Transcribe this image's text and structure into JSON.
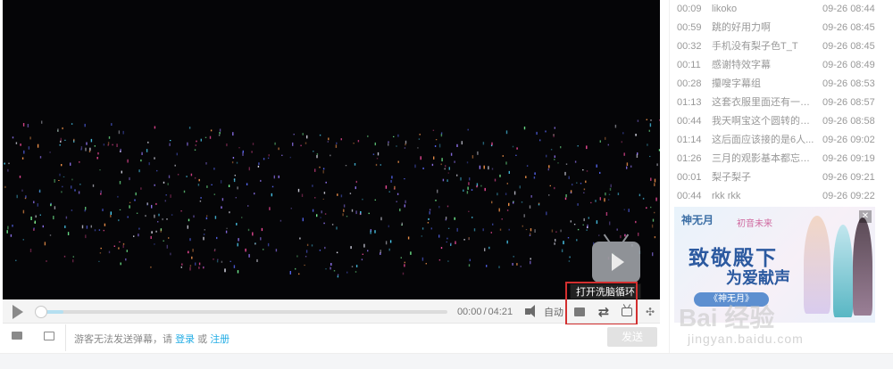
{
  "player": {
    "big_play_icon": "tv-play-icon",
    "tooltip": "打开洗脑循环",
    "time_current": "00:00",
    "time_separator": "/",
    "time_total": "04:21",
    "progress": 0,
    "auto_label": "自动",
    "loop_icon": "loop-icon",
    "accent": "#23ade5",
    "highlight_color": "#d32f2f"
  },
  "sendbar": {
    "hint_prefix": "游客无法发送弹幕，请",
    "login": "登录",
    "or": "或",
    "register": "注册",
    "send": "发送"
  },
  "danmaku": [
    {
      "time": "00:09",
      "content": "likoko",
      "date": "09-26 08:44"
    },
    {
      "time": "00:59",
      "content": "跳的好用力啊",
      "date": "09-26 08:45"
    },
    {
      "time": "00:32",
      "content": "手机没有梨子色T_T",
      "date": "09-26 08:45"
    },
    {
      "time": "00:11",
      "content": "感谢特效字幕",
      "date": "09-26 08:49"
    },
    {
      "time": "00:28",
      "content": "攥嗖字幕组",
      "date": "09-26 08:53"
    },
    {
      "time": "01:13",
      "content": "这套衣服里面还有一套...",
      "date": "09-26 08:57"
    },
    {
      "time": "00:44",
      "content": "我天啊宝这个圆转的要...",
      "date": "09-26 08:58"
    },
    {
      "time": "01:14",
      "content": "这后面应该接的是6人...",
      "date": "09-26 09:02"
    },
    {
      "time": "01:26",
      "content": "三月的观影基本都忘光...",
      "date": "09-26 09:19"
    },
    {
      "time": "00:01",
      "content": "梨子梨子",
      "date": "09-26 09:21"
    },
    {
      "time": "00:44",
      "content": "rkk rkk",
      "date": "09-26 09:22"
    }
  ],
  "ad": {
    "logo": "神无月",
    "logo2": "初音未来",
    "headline": "致敬殿下",
    "sub": "为爱献声",
    "button": "《神无月》",
    "close": "✕"
  },
  "watermark": {
    "main": "Bai 经验",
    "url": "jingyan.baidu.com"
  }
}
